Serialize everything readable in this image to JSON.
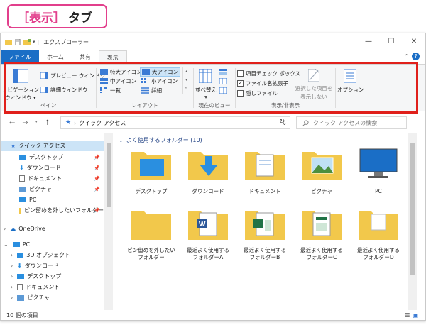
{
  "callout": {
    "keyword": "［表示］",
    "rest": "タブ",
    "color": "#e23f8c"
  },
  "window": {
    "title": "エクスプローラー",
    "controls": [
      "—",
      "☐",
      "✕"
    ]
  },
  "tabs": [
    "ファイル",
    "ホーム",
    "共有",
    "表示"
  ],
  "ribbon": {
    "pane": {
      "label": "ペイン",
      "nav_pane": [
        "ナビゲーション",
        "ウィンドウ ▾"
      ],
      "preview": "プレビュー ウィンドウ",
      "details": "詳細ウィンドウ"
    },
    "layout": {
      "label": "レイアウト",
      "items": [
        "特大アイコン",
        "大アイコン",
        "中アイコン",
        "小アイコン",
        "一覧",
        "詳細"
      ]
    },
    "current_view": {
      "label": "現在のビュー",
      "sort": [
        "並べ替え",
        "▾"
      ]
    },
    "show_hide": {
      "label": "表示/非表示",
      "item_check": "項目チェック ボックス",
      "file_ext": "ファイル名拡張子",
      "hidden": "隠しファイル",
      "hide_selected": [
        "選択した項目を",
        "表示しない"
      ]
    },
    "options": "オプション"
  },
  "address": {
    "path": "クイック アクセス",
    "search_placeholder": "クイック アクセスの検索"
  },
  "nav": {
    "quick_access": "クイック アクセス",
    "items": [
      "デスクトップ",
      "ダウンロード",
      "ドキュメント",
      "ピクチャ",
      "PC",
      "ピン留めを外したいフォルダー"
    ],
    "onedrive": "OneDrive",
    "pc": "PC",
    "pc_items": [
      "3D オブジェクト",
      "ダウンロード",
      "デスクトップ",
      "ドキュメント",
      "ピクチャ"
    ]
  },
  "content": {
    "section": "よく使用するフォルダー (10)",
    "row1": [
      "デスクトップ",
      "ダウンロード",
      "ドキュメント",
      "ピクチャ",
      "PC"
    ],
    "row2": [
      [
        "ピン留めを外したい",
        "フォルダー"
      ],
      [
        "最近よく使用する",
        "フォルダーA"
      ],
      [
        "最近よく使用する",
        "フォルダーB"
      ],
      [
        "最近よく使用する",
        "フォルダーC"
      ],
      [
        "最近よく使用する",
        "フォルダーD"
      ]
    ]
  },
  "status": "10 個の項目",
  "colors": {
    "accent": "#1a6ec6",
    "highlight": "#e0201b",
    "folder": "#f2c84b"
  }
}
